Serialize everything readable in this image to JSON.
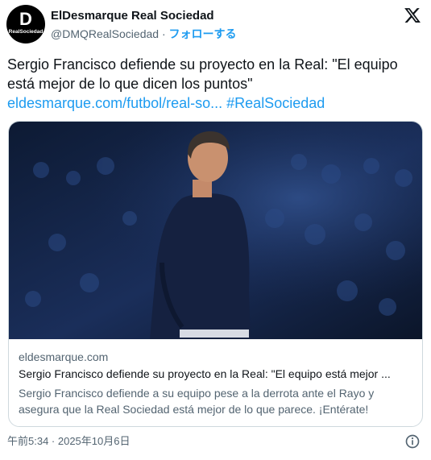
{
  "author": {
    "avatar_logo_letter": "D",
    "avatar_logo_text": "RealSociedad",
    "name": "ElDesmarque Real Sociedad",
    "handle": "@DMQRealSociedad",
    "separator": "·",
    "follow_label": "フォローする"
  },
  "tweet": {
    "text": "Sergio Francisco defiende su proyecto en la Real: \"El equipo está mejor de lo que dicen los puntos\"",
    "link": "eldesmarque.com/futbol/real-so...",
    "hashtag": "#RealSociedad"
  },
  "card": {
    "domain": "eldesmarque.com",
    "title": "Sergio Francisco defiende su proyecto en la Real: \"El equipo está mejor ...",
    "description": "Sergio Francisco defiende a su equipo pese a la derrota ante el Rayo y asegura que la Real Sociedad está mejor de lo que parece. ¡Entérate!"
  },
  "timestamp": "午前5:34 · 2025年10月6日",
  "icons": {
    "platform": "x-logo-icon",
    "info": "info-icon"
  },
  "colors": {
    "accent": "#1d9bf0",
    "muted": "#536471",
    "border": "#cfd9de"
  }
}
